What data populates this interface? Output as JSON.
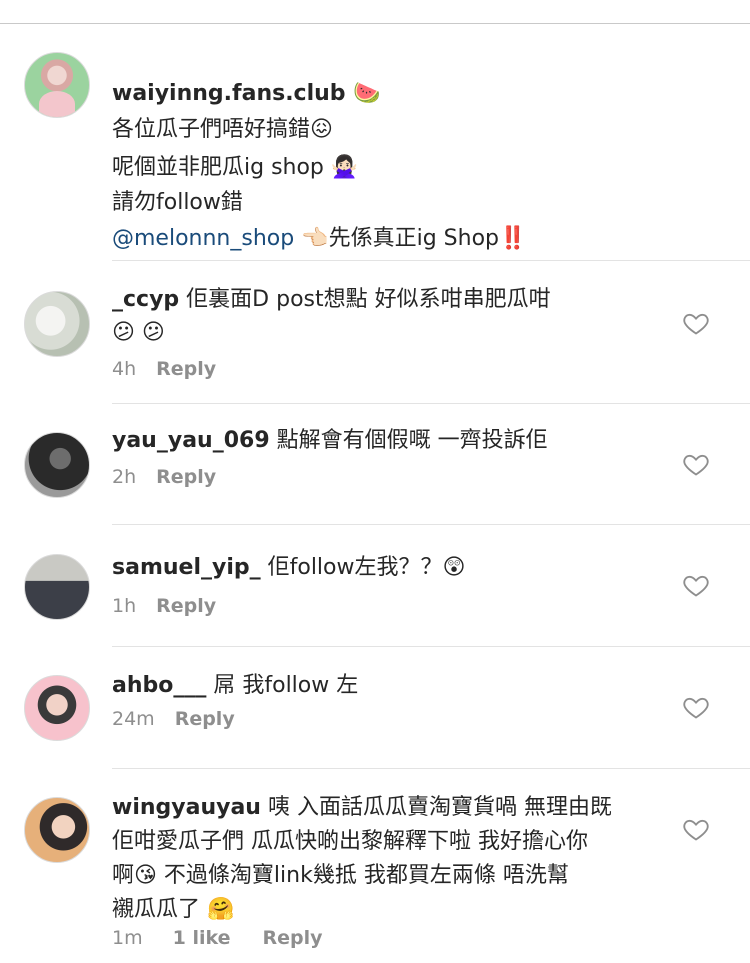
{
  "caption": {
    "username": "waiyinng.fans.club",
    "user_emoji": "🍉",
    "lines": [
      "各位瓜子們唔好搞錯😖",
      "呢個並非肥瓜ig shop 🙅🏻‍♀️",
      "請勿follow錯"
    ],
    "mention": "@melonnn_shop",
    "last_line_rest": " 👈🏻先係真正ig Shop‼️"
  },
  "comments": [
    {
      "username": "_ccyp",
      "text": " 佢裏面D post想點 好似系咁串肥瓜咁",
      "text2": "😕 😕",
      "time": "4h",
      "likes": "",
      "reply": "Reply"
    },
    {
      "username": "yau_yau_069",
      "text": " 點解會有個假嘅 一齊投訴佢",
      "text2": "",
      "time": "2h",
      "likes": "",
      "reply": "Reply"
    },
    {
      "username": "samuel_yip_",
      "text": " 佢follow左我？？😲",
      "text2": "",
      "time": "1h",
      "likes": "",
      "reply": "Reply"
    },
    {
      "username": "ahbo___",
      "text": " 屌 我follow 左",
      "text2": "",
      "time": "24m",
      "likes": "",
      "reply": "Reply"
    },
    {
      "username": "wingyauyau",
      "text": " 咦 入面話瓜瓜賣淘寶貨喎 無理由既",
      "text2": "佢咁愛瓜子們 瓜瓜快啲出黎解釋下啦 我好擔心你",
      "text3": "啊😘 不過條淘寶link幾抵 我都買左兩條 唔洗幫",
      "text4": "襯瓜瓜了 🤗",
      "time": "1m",
      "likes": "1 like",
      "reply": "Reply"
    }
  ]
}
